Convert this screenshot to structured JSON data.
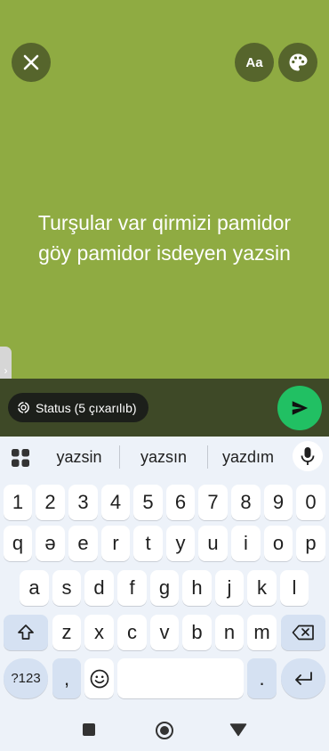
{
  "status": {
    "text": "Turşular var qirmizi pamidor\ngöy pamidor isdeyen yazsin",
    "background_color": "#8fab42",
    "font_button_label": "Aa"
  },
  "compose": {
    "audience_label": "Status (5 çıxarılıb)"
  },
  "keyboard": {
    "suggestions": [
      "yazsin",
      "yazsın",
      "yazdım"
    ],
    "number_row": [
      "1",
      "2",
      "3",
      "4",
      "5",
      "6",
      "7",
      "8",
      "9",
      "0"
    ],
    "row1": [
      "q",
      "ə",
      "e",
      "r",
      "t",
      "y",
      "u",
      "i",
      "o",
      "p"
    ],
    "row2": [
      "a",
      "s",
      "d",
      "f",
      "g",
      "h",
      "j",
      "k",
      "l"
    ],
    "row3": [
      "z",
      "x",
      "c",
      "v",
      "b",
      "n",
      "m"
    ],
    "symbols_label": "?123",
    "comma": ",",
    "period": "."
  },
  "colors": {
    "send": "#21c063",
    "keyboard_bg": "#edf2f9",
    "fn_key": "#d5e1f2"
  }
}
